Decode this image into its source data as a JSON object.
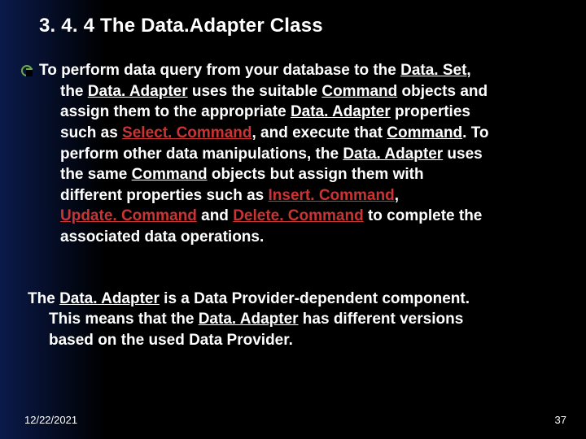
{
  "heading": "3. 4. 4   The Data.Adapter Class",
  "para1": {
    "line1_prefix": "To perform data query from your database to the ",
    "dataset": "Data. Set",
    "line1_suffix": ",",
    "line2a": "the ",
    "dataadapter1": "Data. Adapter",
    "line2b": " uses the suitable ",
    "command1": "Command",
    "line2c": " objects and",
    "line3a": "assign them to the appropriate ",
    "dataadapter2": "Data. Adapter",
    "line3b": " properties",
    "line4a": "such as ",
    "selectcmd": "Select. Command",
    "line4b": ", and execute that ",
    "command2": "Command",
    "line4c": ". To",
    "line5a": "perform other data manipulations, the ",
    "dataadapter3": "Data. Adapter",
    "line5b": " uses",
    "line6a": "the same ",
    "command3": "Command",
    "line6b": " objects but assign them with",
    "line7a": "different properties such as ",
    "insertcmd": "Insert. Command",
    "line7b": ",",
    "updatecmd": "Update. Command",
    "line8a": " and ",
    "deletecmd": "Delete. Command",
    "line8b": " to complete the",
    "line9": "associated data operations."
  },
  "para2": {
    "line1a": "The ",
    "dataadapter4": "Data. Adapter",
    "line1b": " is a Data Provider-dependent component.",
    "line2a": "This means that the ",
    "dataadapter5": "Data. Adapter",
    "line2b": " has different versions",
    "line3": "based on the used Data Provider."
  },
  "footer": {
    "date": "12/22/2021",
    "page": "37"
  }
}
